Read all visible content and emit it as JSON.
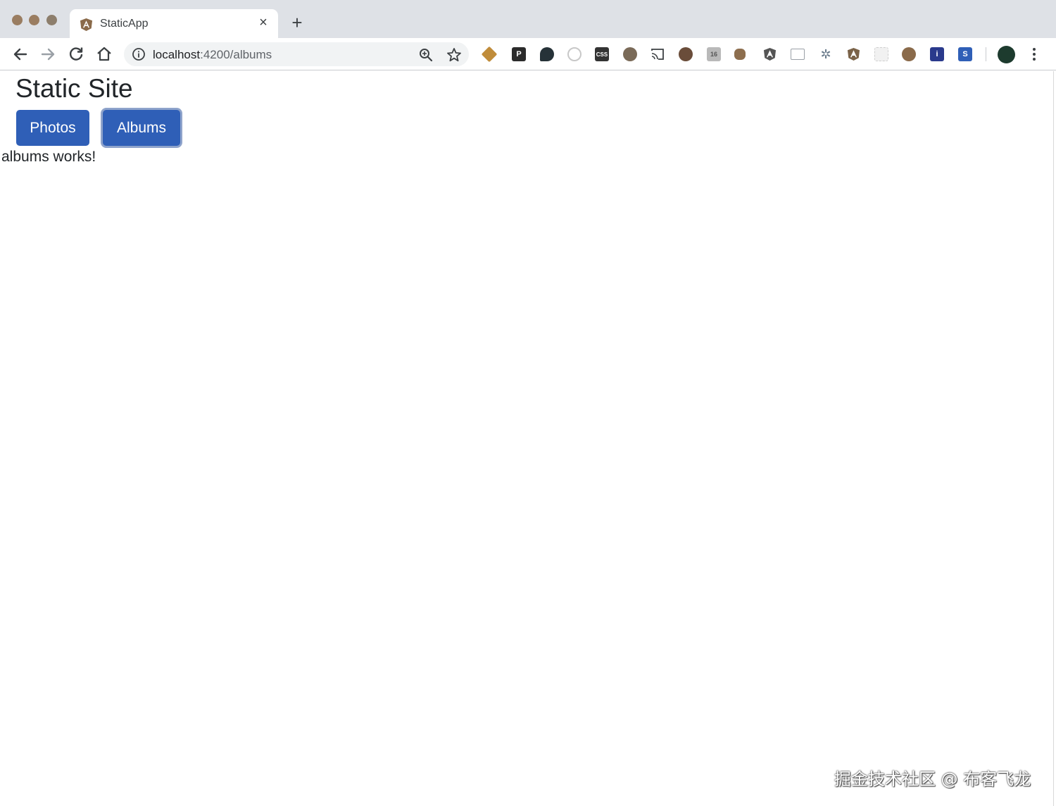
{
  "browser": {
    "tab": {
      "title": "StaticApp",
      "favicon": "angular-icon"
    },
    "address_bar": {
      "host": "localhost",
      "path": ":4200/albums"
    },
    "extensions": [
      "extension-compass-icon",
      "extension-p-icon",
      "extension-balloon-icon",
      "extension-clock-icon",
      "extension-css-icon",
      "extension-shield-icon",
      "extension-cast-icon",
      "extension-globe-icon",
      "extension-image-icon",
      "extension-puzzle-icon",
      "extension-angular-icon",
      "extension-window-icon",
      "extension-gear-icon",
      "extension-angular-alt-icon",
      "extension-grid-icon",
      "extension-firefox-icon",
      "extension-info-icon",
      "extension-s-icon"
    ],
    "colors": {
      "tab_strip": "#dee1e6",
      "omnibox": "#f1f3f4"
    }
  },
  "page": {
    "title": "Static Site",
    "nav": [
      {
        "label": "Photos",
        "state": "default"
      },
      {
        "label": "Albums",
        "state": "focused"
      }
    ],
    "content_text": "albums works!",
    "colors": {
      "button": "#2f5fb7",
      "focus_ring": "#8ea3cb"
    }
  },
  "watermark": "掘金技术社区 @ 布客飞龙"
}
